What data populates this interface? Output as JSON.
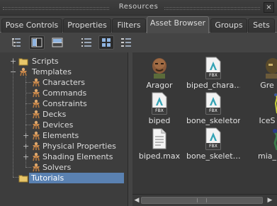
{
  "window": {
    "title": "Resources",
    "close_glyph": "×"
  },
  "tabs": [
    {
      "label": "Pose Controls",
      "active": false
    },
    {
      "label": "Properties",
      "active": false
    },
    {
      "label": "Filters",
      "active": false
    },
    {
      "label": "Asset Browser",
      "active": true
    },
    {
      "label": "Groups",
      "active": false
    },
    {
      "label": "Sets",
      "active": false
    }
  ],
  "toolbar": {
    "buttons": [
      {
        "icon": "tree-view-icon",
        "selected": false
      },
      {
        "icon": "split-view-icon",
        "selected": true
      },
      {
        "icon": "horizontal-split-icon",
        "selected": false
      },
      {
        "icon": "list-view-icon",
        "selected": false
      },
      {
        "icon": "icon-view-icon",
        "selected": true
      },
      {
        "icon": "detail-view-icon",
        "selected": false
      }
    ]
  },
  "tree": {
    "items": [
      {
        "label": "Scripts",
        "icon": "folder-icon",
        "expander": "+",
        "selected": false
      },
      {
        "label": "Templates",
        "icon": "template-icon",
        "expander": "−",
        "selected": false
      },
      {
        "label": "Characters",
        "icon": "template-icon",
        "expander": "",
        "selected": false
      },
      {
        "label": "Commands",
        "icon": "template-icon",
        "expander": "",
        "selected": false
      },
      {
        "label": "Constraints",
        "icon": "template-icon",
        "expander": "",
        "selected": false
      },
      {
        "label": "Decks",
        "icon": "template-icon",
        "expander": "",
        "selected": false
      },
      {
        "label": "Devices",
        "icon": "template-icon",
        "expander": "",
        "selected": false
      },
      {
        "label": "Elements",
        "icon": "template-icon",
        "expander": "+",
        "selected": false
      },
      {
        "label": "Physical Properties",
        "icon": "template-icon",
        "expander": "+",
        "selected": false
      },
      {
        "label": "Shading Elements",
        "icon": "template-icon",
        "expander": "+",
        "selected": false
      },
      {
        "label": "Solvers",
        "icon": "template-icon",
        "expander": "",
        "selected": false
      },
      {
        "label": "Tutorials",
        "icon": "folder-icon",
        "expander": "",
        "selected": true
      }
    ]
  },
  "assets": {
    "items": [
      {
        "name": "Aragor",
        "icon": "character-head-icon"
      },
      {
        "name": "biped_chara…",
        "icon": "fbx-file-icon"
      },
      {
        "name": "Gre",
        "icon": "character-head-icon"
      },
      {
        "name": "biped",
        "icon": "fbx-file-icon"
      },
      {
        "name": "bone_skeleton",
        "icon": "fbx-file-icon"
      },
      {
        "name": "IceS",
        "icon": "character-figure-icon"
      },
      {
        "name": "biped.max",
        "icon": "document-icon"
      },
      {
        "name": "bone_skelet…",
        "icon": "fbx-file-icon"
      },
      {
        "name": "mia_",
        "icon": "character-figure-icon"
      }
    ],
    "fbx_label": "FBX"
  },
  "scrollbar": {
    "left_glyph": "◀",
    "right_glyph": "▶",
    "position": 0.0
  },
  "colors": {
    "selection": "#5a81b1",
    "background": "#444444",
    "panel": "#3d3d3d"
  }
}
